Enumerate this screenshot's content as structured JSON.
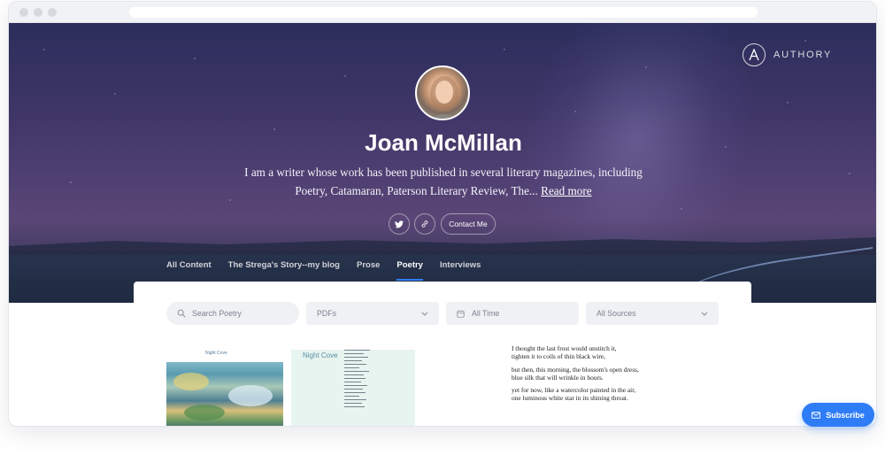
{
  "brand": {
    "name": "AUTHORY"
  },
  "profile": {
    "name": "Joan McMillan",
    "bio_line1": "I am a writer whose work has been published in several literary magazines, including",
    "bio_line2": "Poetry, Catamaran, Paterson Literary Review, The...",
    "read_more": "Read more",
    "contact_label": "Contact Me"
  },
  "icons": {
    "brand": "authory-logo-icon",
    "twitter": "twitter-icon",
    "link": "link-icon",
    "search": "search-icon",
    "chevron": "chevron-down-icon",
    "calendar": "calendar-icon",
    "mail": "mail-icon"
  },
  "tabs": [
    {
      "label": "All Content",
      "active": false
    },
    {
      "label": "The Strega's Story--my blog",
      "active": false
    },
    {
      "label": "Prose",
      "active": false
    },
    {
      "label": "Poetry",
      "active": true
    },
    {
      "label": "Interviews",
      "active": false
    }
  ],
  "filters": {
    "search_placeholder": "Search Poetry",
    "type": "PDFs",
    "time": "All Time",
    "sources": "All Sources"
  },
  "items": {
    "thumb1_title": "Night Cove",
    "thumb2_title": "Night Cove",
    "poem_lines": [
      "I thought the last frost would unstitch it,",
      "tighten it to coils of thin black wire,",
      "but then, this morning, the blossom's open dress,",
      "blue silk that will wrinkle in hours.",
      "yet for now, like a watercolor painted in the air,",
      "one luminous white star in its shining throat."
    ]
  },
  "subscribe": {
    "label": "Subscribe"
  },
  "colors": {
    "accent": "#2f7df6",
    "hero": "#3d3566"
  }
}
